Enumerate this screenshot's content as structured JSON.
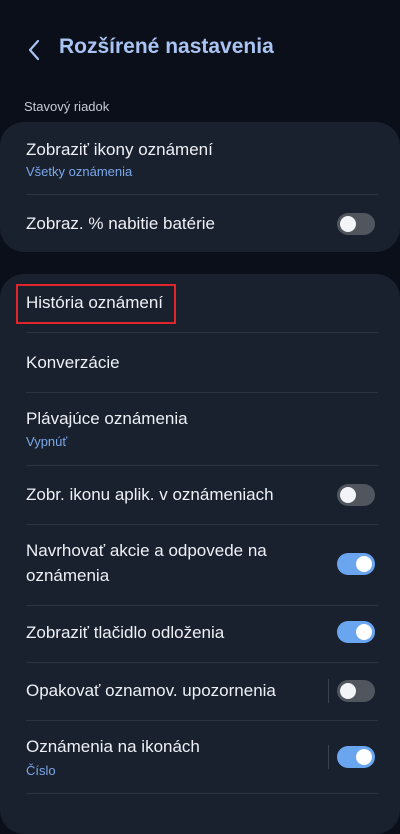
{
  "header": {
    "title": "Rozšírené nastavenia",
    "back_icon": "chevron-left-icon"
  },
  "status_bar_section": {
    "label": "Stavový riadok",
    "items": [
      {
        "title": "Zobraziť ikony oznámení",
        "subtitle": "Všetky oznámenia"
      },
      {
        "title": "Zobraz. % nabitie batérie",
        "toggle": "off"
      }
    ]
  },
  "notifications_section": {
    "items": [
      {
        "title": "História oznámení",
        "highlighted": true
      },
      {
        "title": "Konverzácie"
      },
      {
        "title": "Plávajúce oznámenia",
        "subtitle": "Vypnúť"
      },
      {
        "title": "Zobr. ikonu aplik. v oznámeniach",
        "toggle": "off"
      },
      {
        "title_line1": "Navrhovať akcie a odpovede na",
        "title_line2": "oznámenia",
        "toggle": "on"
      },
      {
        "title": "Zobraziť tlačidlo odloženia",
        "toggle": "on"
      },
      {
        "title": "Opakovať oznamov. upozornenia",
        "toggle": "off"
      },
      {
        "title": "Oznámenia na ikonách",
        "subtitle": "Číslo",
        "toggle": "on"
      }
    ]
  },
  "colors": {
    "background": "#0a0f1a",
    "card": "#19202e",
    "accent": "#a9c4f2",
    "subtitle": "#7ba8ea",
    "toggle_on": "#6aa5ef",
    "toggle_off": "#50555e",
    "highlight_border": "#e0262a"
  }
}
